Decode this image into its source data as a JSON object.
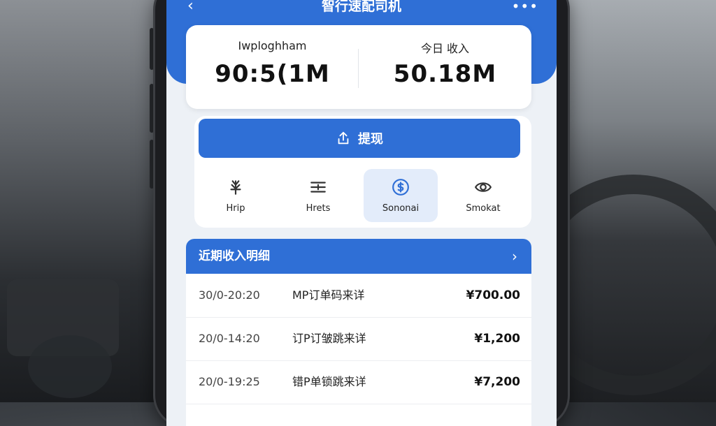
{
  "app": {
    "title": "智行速配司机",
    "back_glyph": "‹",
    "more_glyph": "•••"
  },
  "stats": {
    "left": {
      "label": "Iwploghham",
      "value": "90:5(1M"
    },
    "right": {
      "label": "今日 收入",
      "value": "50.18M"
    }
  },
  "withdraw": {
    "label": "提现",
    "icon": "upload-icon"
  },
  "quick_actions": [
    {
      "label": "Hrip",
      "icon": "yen-sprout-icon",
      "active": false
    },
    {
      "label": "Hrets",
      "icon": "sliders-icon",
      "active": false
    },
    {
      "label": "Sononai",
      "icon": "dollar-circle-icon",
      "active": true
    },
    {
      "label": "Smokat",
      "icon": "eye-icon",
      "active": false
    }
  ],
  "recent": {
    "title": "近期收入明细",
    "arrow": "›",
    "rows": [
      {
        "time": "30/0-20:20",
        "desc": "MP订单码来详",
        "amount": "¥700.00"
      },
      {
        "time": "20/0-14:20",
        "desc": "订P订皱跳来详",
        "amount": "¥1,200"
      },
      {
        "time": "20/0-19:25",
        "desc": "错P单锁跳来详",
        "amount": "¥7,200"
      }
    ]
  },
  "colors": {
    "primary": "#2f6fd6",
    "active_bg": "#e3ecfa",
    "card_bg": "#ffffff",
    "screen_bg": "#edf1f6"
  }
}
